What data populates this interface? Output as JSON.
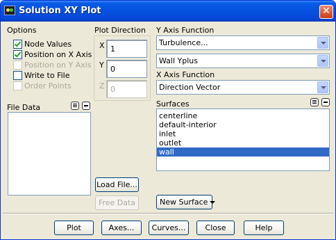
{
  "window": {
    "title": "Solution XY Plot",
    "close_glyph": "✕"
  },
  "options": {
    "label": "Options",
    "items": [
      {
        "label": "Node Values",
        "checked": true,
        "enabled": true
      },
      {
        "label": "Position on X Axis",
        "checked": true,
        "enabled": true
      },
      {
        "label": "Position on Y Axis",
        "checked": false,
        "enabled": false
      },
      {
        "label": "Write to File",
        "checked": false,
        "enabled": true
      },
      {
        "label": "Order Points",
        "checked": false,
        "enabled": false
      }
    ]
  },
  "plot_direction": {
    "label": "Plot Direction",
    "x_label": "X",
    "x_value": "1",
    "y_label": "Y",
    "y_value": "0",
    "z_label": "Z",
    "z_value": "0"
  },
  "y_axis_function": {
    "label": "Y Axis Function",
    "category": "Turbulence...",
    "quantity": "Wall Yplus"
  },
  "x_axis_function": {
    "label": "X Axis Function",
    "value": "Direction Vector"
  },
  "file_data": {
    "label": "File Data",
    "load_button": "Load File...",
    "free_button": "Free Data"
  },
  "surfaces": {
    "label": "Surfaces",
    "items": [
      "centerline",
      "default-interior",
      "inlet",
      "outlet",
      "wall"
    ],
    "selected_index": 4,
    "new_surface_button": "New Surface"
  },
  "footer": {
    "plot": "Plot",
    "axes": "Axes...",
    "curves": "Curves...",
    "close": "Close",
    "help": "Help"
  },
  "colors": {
    "titlebar": "#0451de",
    "dialog_bg": "#ece9d8",
    "selection": "#316ac5",
    "check": "#21a121"
  }
}
